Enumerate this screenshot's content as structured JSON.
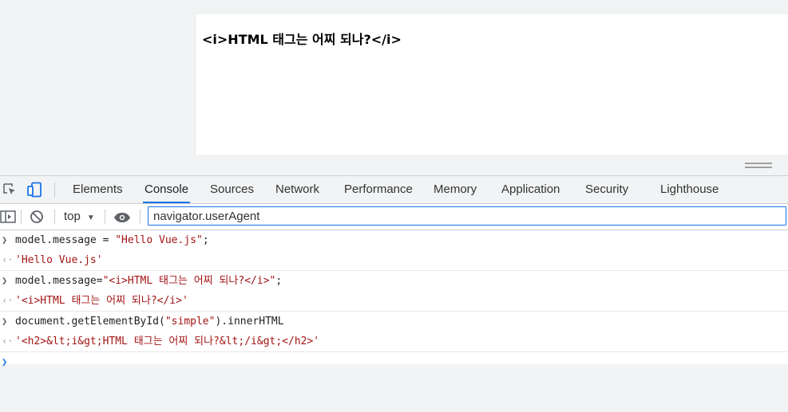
{
  "preview": {
    "heading": "<i>HTML 태그는 어찌 되나?</i>"
  },
  "devtools": {
    "tabs": [
      {
        "label": "Elements"
      },
      {
        "label": "Console",
        "active": true
      },
      {
        "label": "Sources"
      },
      {
        "label": "Network"
      },
      {
        "label": "Performance"
      },
      {
        "label": "Memory"
      },
      {
        "label": "Application"
      },
      {
        "label": "Security"
      },
      {
        "label": "Lighthouse"
      }
    ],
    "icons": {
      "inspect": "inspect-element-icon",
      "device": "device-toolbar-icon"
    }
  },
  "console_toolbar": {
    "context": "top",
    "filter_value": "navigator.userAgent",
    "icons": {
      "sidebar": "sidebar-toggle-icon",
      "clear": "clear-console-icon",
      "live_expression": "eye-icon"
    }
  },
  "console": {
    "entries": [
      {
        "kind": "input",
        "code_a": "model.message = ",
        "code_b": "\"Hello Vue.js\"",
        "code_c": ";"
      },
      {
        "kind": "result",
        "value": "'Hello Vue.js'"
      },
      {
        "kind": "input",
        "code_a": "model.message=",
        "code_b": "\"<i>HTML 태그는 어찌 되나?</i>\"",
        "code_c": ";"
      },
      {
        "kind": "result",
        "value": "'<i>HTML 태그는 어찌 되나?</i>'"
      },
      {
        "kind": "input",
        "code_a": "document.getElementById(",
        "code_b": "\"simple\"",
        "code_c": ").innerHTML"
      },
      {
        "kind": "result",
        "value": "'<h2>&lt;i&gt;HTML 태그는 어찌 되나?&lt;/i&gt;</h2>'"
      }
    ]
  },
  "colors": {
    "accent": "#1a73e8",
    "string": "#a31515"
  }
}
